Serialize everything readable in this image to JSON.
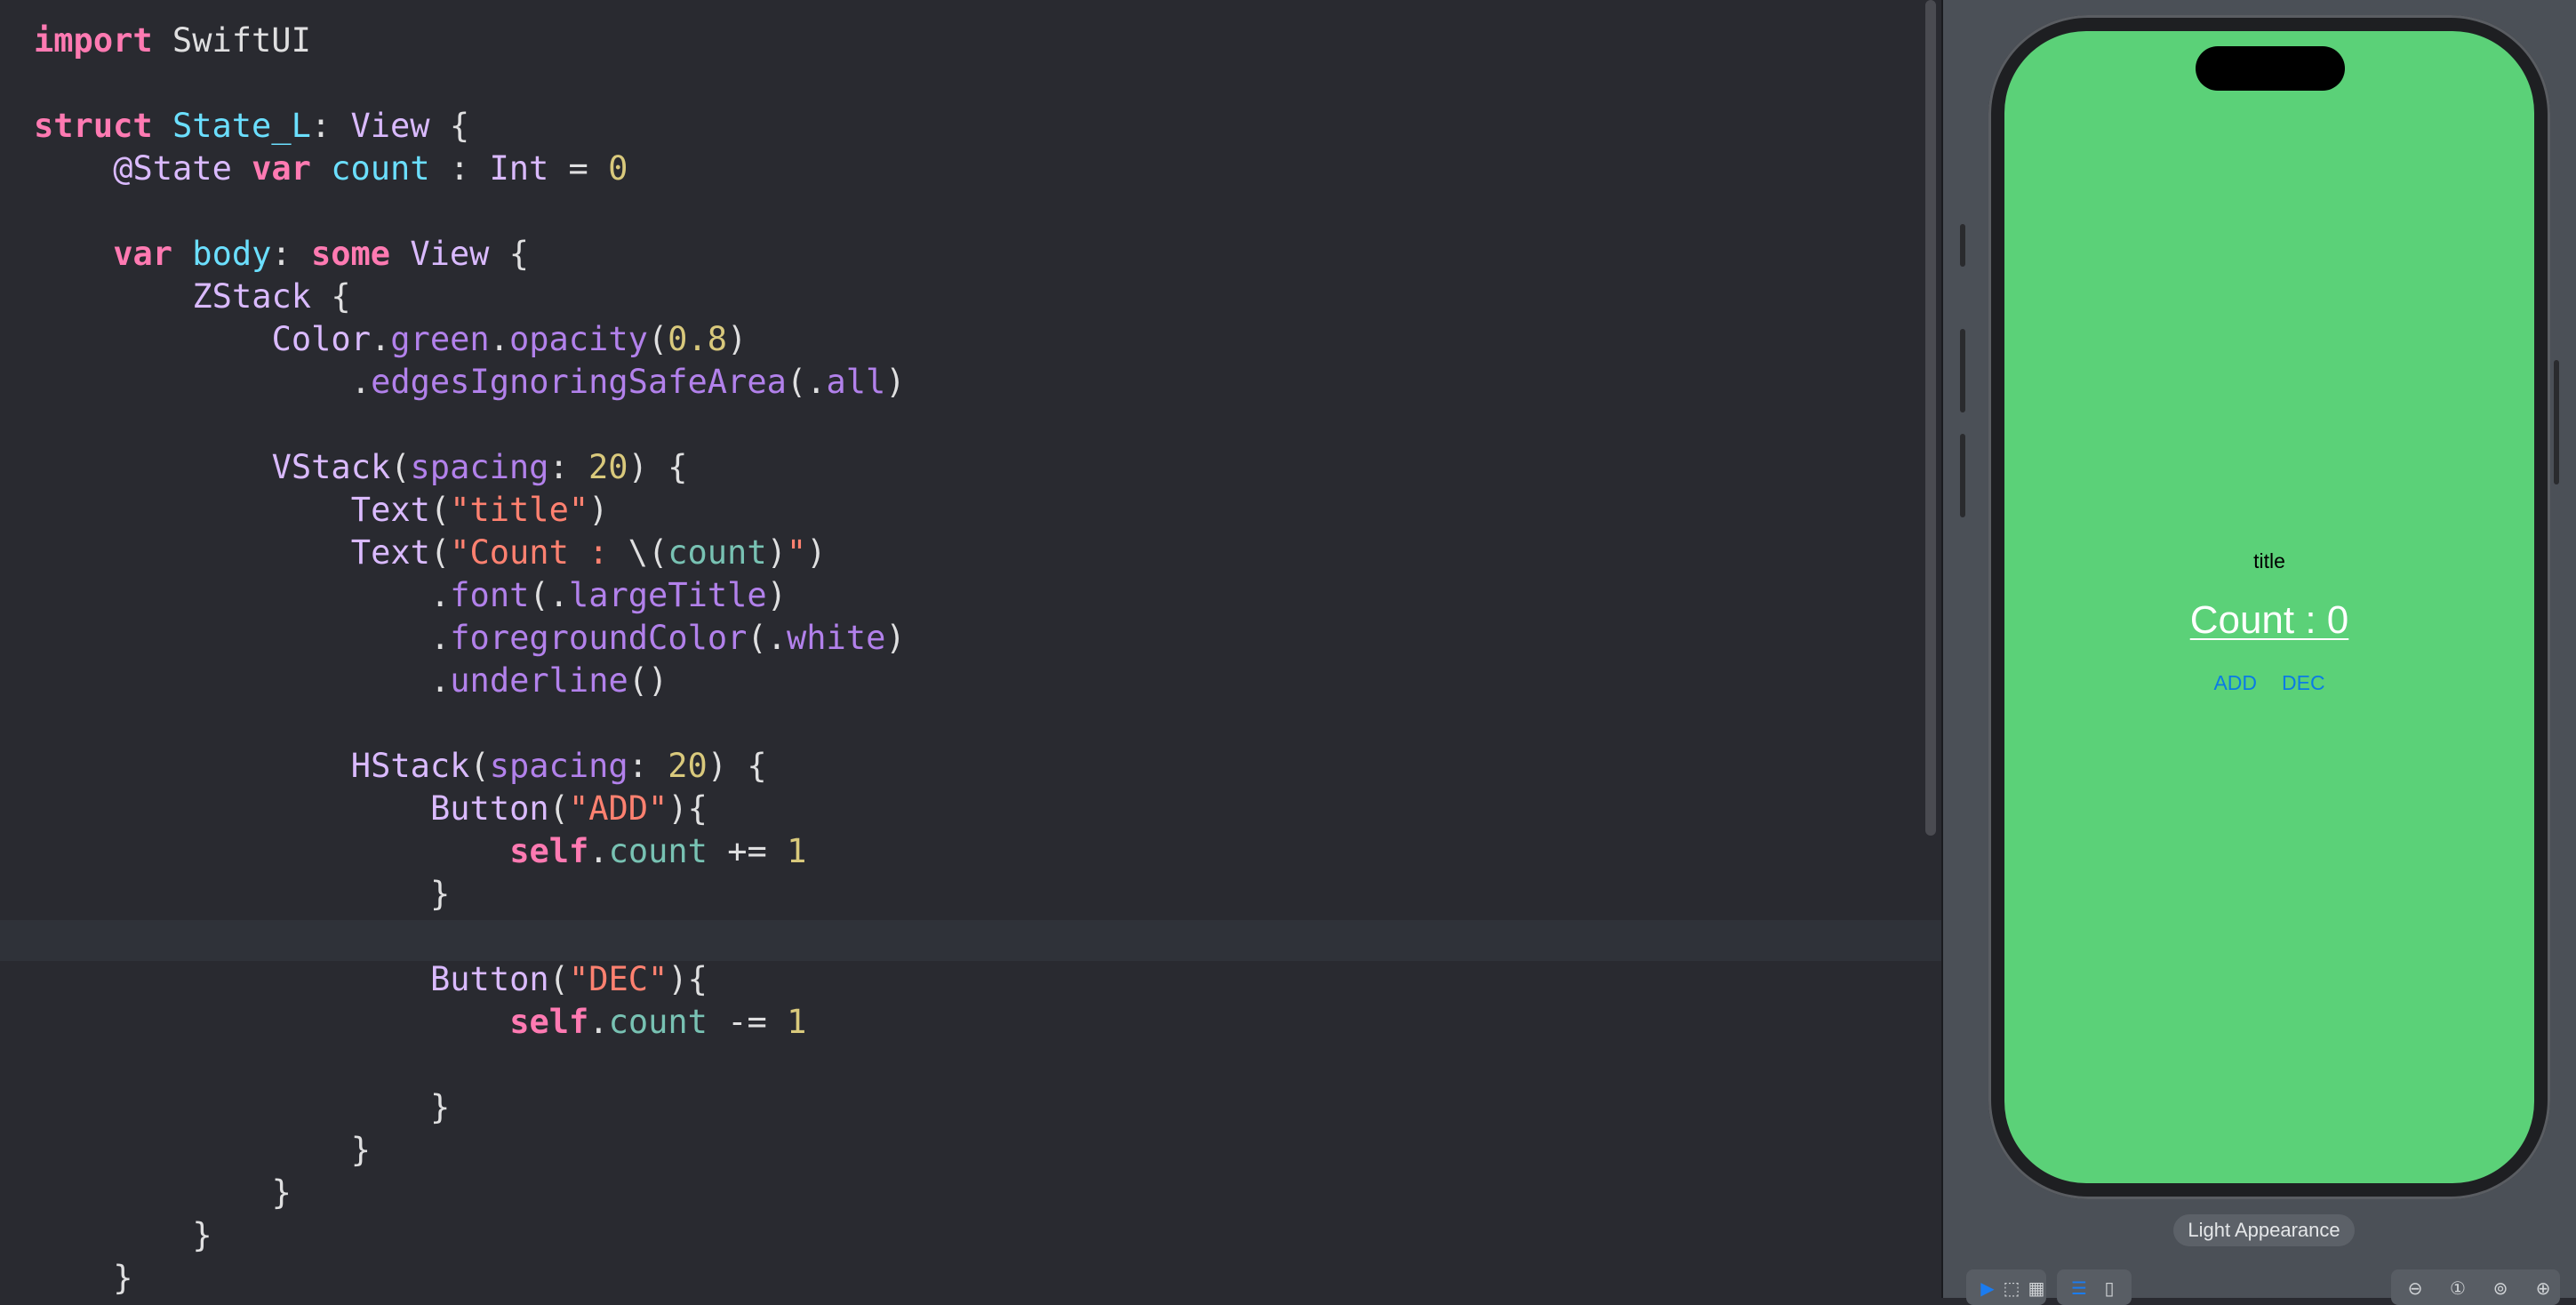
{
  "editor": {
    "lines": [
      {
        "indent": 0,
        "tokens": [
          [
            "kw",
            "import"
          ],
          [
            "plain",
            " SwiftUI"
          ]
        ]
      },
      {
        "indent": 0,
        "tokens": []
      },
      {
        "indent": 0,
        "tokens": [
          [
            "kw",
            "struct"
          ],
          [
            "plain",
            " "
          ],
          [
            "decl",
            "State_L"
          ],
          [
            "plain",
            ": "
          ],
          [
            "typ",
            "View"
          ],
          [
            "plain",
            " {"
          ]
        ]
      },
      {
        "indent": 4,
        "tokens": [
          [
            "typ",
            "@State"
          ],
          [
            "plain",
            " "
          ],
          [
            "kw",
            "var"
          ],
          [
            "plain",
            " "
          ],
          [
            "decl",
            "count"
          ],
          [
            "plain",
            " : "
          ],
          [
            "typ",
            "Int"
          ],
          [
            "plain",
            " = "
          ],
          [
            "num",
            "0"
          ]
        ]
      },
      {
        "indent": 0,
        "tokens": []
      },
      {
        "indent": 4,
        "tokens": [
          [
            "kw",
            "var"
          ],
          [
            "plain",
            " "
          ],
          [
            "decl",
            "body"
          ],
          [
            "plain",
            ": "
          ],
          [
            "kw",
            "some"
          ],
          [
            "plain",
            " "
          ],
          [
            "typ",
            "View"
          ],
          [
            "plain",
            " {"
          ]
        ]
      },
      {
        "indent": 8,
        "tokens": [
          [
            "typ",
            "ZStack"
          ],
          [
            "plain",
            " {"
          ]
        ]
      },
      {
        "indent": 12,
        "tokens": [
          [
            "typ",
            "Color"
          ],
          [
            "plain",
            "."
          ],
          [
            "fn",
            "green"
          ],
          [
            "plain",
            "."
          ],
          [
            "fn",
            "opacity"
          ],
          [
            "plain",
            "("
          ],
          [
            "num",
            "0.8"
          ],
          [
            "plain",
            ")"
          ]
        ]
      },
      {
        "indent": 16,
        "tokens": [
          [
            "plain",
            "."
          ],
          [
            "fn",
            "edgesIgnoringSafeArea"
          ],
          [
            "plain",
            "(."
          ],
          [
            "fn",
            "all"
          ],
          [
            "plain",
            ")"
          ]
        ]
      },
      {
        "indent": 0,
        "tokens": []
      },
      {
        "indent": 12,
        "tokens": [
          [
            "typ",
            "VStack"
          ],
          [
            "plain",
            "("
          ],
          [
            "fn",
            "spacing"
          ],
          [
            "plain",
            ": "
          ],
          [
            "num",
            "20"
          ],
          [
            "plain",
            ") {"
          ]
        ]
      },
      {
        "indent": 16,
        "tokens": [
          [
            "typ",
            "Text"
          ],
          [
            "plain",
            "("
          ],
          [
            "str",
            "\"title\""
          ],
          [
            "plain",
            ")"
          ]
        ]
      },
      {
        "indent": 16,
        "tokens": [
          [
            "typ",
            "Text"
          ],
          [
            "plain",
            "("
          ],
          [
            "str",
            "\"Count : "
          ],
          [
            "plain",
            "\\("
          ],
          [
            "prop",
            "count"
          ],
          [
            "plain",
            ")"
          ],
          [
            "str",
            "\""
          ],
          [
            "plain",
            ")"
          ]
        ]
      },
      {
        "indent": 20,
        "tokens": [
          [
            "plain",
            "."
          ],
          [
            "fn",
            "font"
          ],
          [
            "plain",
            "(."
          ],
          [
            "fn",
            "largeTitle"
          ],
          [
            "plain",
            ")"
          ]
        ]
      },
      {
        "indent": 20,
        "tokens": [
          [
            "plain",
            "."
          ],
          [
            "fn",
            "foregroundColor"
          ],
          [
            "plain",
            "(."
          ],
          [
            "fn",
            "white"
          ],
          [
            "plain",
            ")"
          ]
        ]
      },
      {
        "indent": 20,
        "tokens": [
          [
            "plain",
            "."
          ],
          [
            "fn",
            "underline"
          ],
          [
            "plain",
            "()"
          ]
        ]
      },
      {
        "indent": 0,
        "tokens": []
      },
      {
        "indent": 16,
        "tokens": [
          [
            "typ",
            "HStack"
          ],
          [
            "plain",
            "("
          ],
          [
            "fn",
            "spacing"
          ],
          [
            "plain",
            ": "
          ],
          [
            "num",
            "20"
          ],
          [
            "plain",
            ") {"
          ]
        ]
      },
      {
        "indent": 20,
        "tokens": [
          [
            "typ",
            "Button"
          ],
          [
            "plain",
            "("
          ],
          [
            "str",
            "\"ADD\""
          ],
          [
            "plain",
            "){"
          ]
        ]
      },
      {
        "indent": 24,
        "tokens": [
          [
            "kw",
            "self"
          ],
          [
            "plain",
            "."
          ],
          [
            "prop",
            "count"
          ],
          [
            "plain",
            " += "
          ],
          [
            "num",
            "1"
          ]
        ]
      },
      {
        "indent": 20,
        "tokens": [
          [
            "plain",
            "}"
          ]
        ]
      },
      {
        "indent": 0,
        "tokens": []
      },
      {
        "indent": 20,
        "tokens": [
          [
            "typ",
            "Button"
          ],
          [
            "plain",
            "("
          ],
          [
            "str",
            "\"DEC\""
          ],
          [
            "plain",
            "){"
          ]
        ]
      },
      {
        "indent": 24,
        "tokens": [
          [
            "kw",
            "self"
          ],
          [
            "plain",
            "."
          ],
          [
            "prop",
            "count"
          ],
          [
            "plain",
            " -= "
          ],
          [
            "num",
            "1"
          ]
        ]
      },
      {
        "indent": 0,
        "tokens": []
      },
      {
        "indent": 20,
        "tokens": [
          [
            "plain",
            "}"
          ]
        ]
      },
      {
        "indent": 16,
        "tokens": [
          [
            "plain",
            "}"
          ]
        ]
      },
      {
        "indent": 12,
        "tokens": [
          [
            "plain",
            "}"
          ]
        ]
      },
      {
        "indent": 8,
        "tokens": [
          [
            "plain",
            "}"
          ]
        ]
      },
      {
        "indent": 4,
        "tokens": [
          [
            "plain",
            "}"
          ]
        ]
      }
    ]
  },
  "preview": {
    "title": "title",
    "count_label": "Count : 0",
    "add_label": "ADD",
    "dec_label": "DEC",
    "appearance_label": "Light Appearance",
    "screen_color": "#5bd178",
    "button_color": "#0a7be5"
  },
  "toolbar": {
    "icons": [
      "live-preview-icon",
      "selectable-icon",
      "variants-icon",
      "device-settings-icon",
      "device-icon",
      "zoom-out-icon",
      "zoom-actual-icon",
      "zoom-fit-icon",
      "zoom-in-icon"
    ]
  }
}
